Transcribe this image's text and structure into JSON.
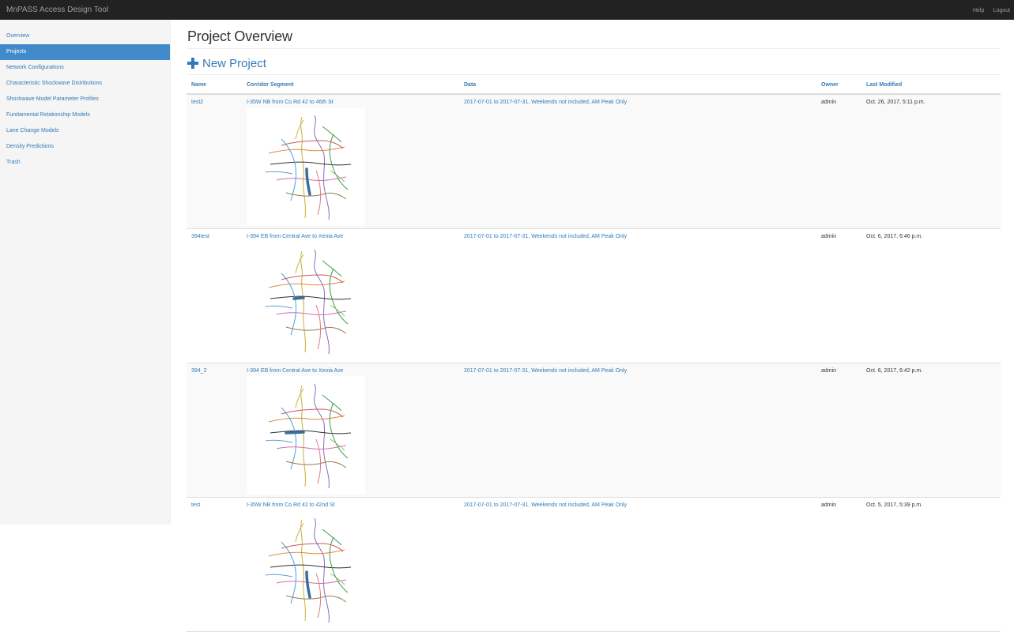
{
  "navbar": {
    "brand": "MnPASS Access Design Tool",
    "help": "Help",
    "logout": "Logout"
  },
  "sidebar": {
    "items": [
      {
        "label": "Overview",
        "active": false
      },
      {
        "label": "Projects",
        "active": true
      },
      {
        "label": "Network Configurations",
        "active": false
      },
      {
        "label": "Characteristic Shockwave Distributions",
        "active": false
      },
      {
        "label": "Shockwave Model Parameter Profiles",
        "active": false
      },
      {
        "label": "Fundamental Relationship Models",
        "active": false
      },
      {
        "label": "Lane Change Models",
        "active": false
      },
      {
        "label": "Density Predictions",
        "active": false
      },
      {
        "label": "Trash",
        "active": false
      }
    ]
  },
  "main": {
    "title": "Project Overview",
    "new_project": "New Project",
    "columns": {
      "name": "Name",
      "corridor": "Corridor Segment",
      "data": "Data",
      "owner": "Owner",
      "modified": "Last Modified"
    },
    "rows": [
      {
        "name": "test2",
        "corridor": "I-35W NB from Co Rd 42 to 46th St",
        "data": "2017-07-01 to 2017-07-31, Weekends not included, AM Peak Only",
        "owner": "admin",
        "modified": "Oct. 26, 2017, 5:11 p.m."
      },
      {
        "name": "394test",
        "corridor": "I-394 EB from Central Ave to Xenia Ave",
        "data": "2017-07-01 to 2017-07-31, Weekends not included, AM Peak Only",
        "owner": "admin",
        "modified": "Oct. 6, 2017, 6:46 p.m."
      },
      {
        "name": "394_2",
        "corridor": "I-394 EB from Central Ave to Xenia Ave",
        "data": "2017-07-01 to 2017-07-31, Weekends not included, AM Peak Only",
        "owner": "admin",
        "modified": "Oct. 6, 2017, 6:42 p.m."
      },
      {
        "name": "test",
        "corridor": "I-35W NB from Co Rd 42 to 42nd St",
        "data": "2017-07-01 to 2017-07-31, Weekends not included, AM Peak Only",
        "owner": "admin",
        "modified": "Oct. 5, 2017, 5:39 p.m."
      }
    ]
  },
  "icons": {
    "new_project": "plus-icon"
  },
  "colors": {
    "navbar": "#222222",
    "sidebar": "#f5f5f5",
    "active_item": "#428bca",
    "link": "#337ab7",
    "selected_corridor": "#3a6f9c"
  }
}
